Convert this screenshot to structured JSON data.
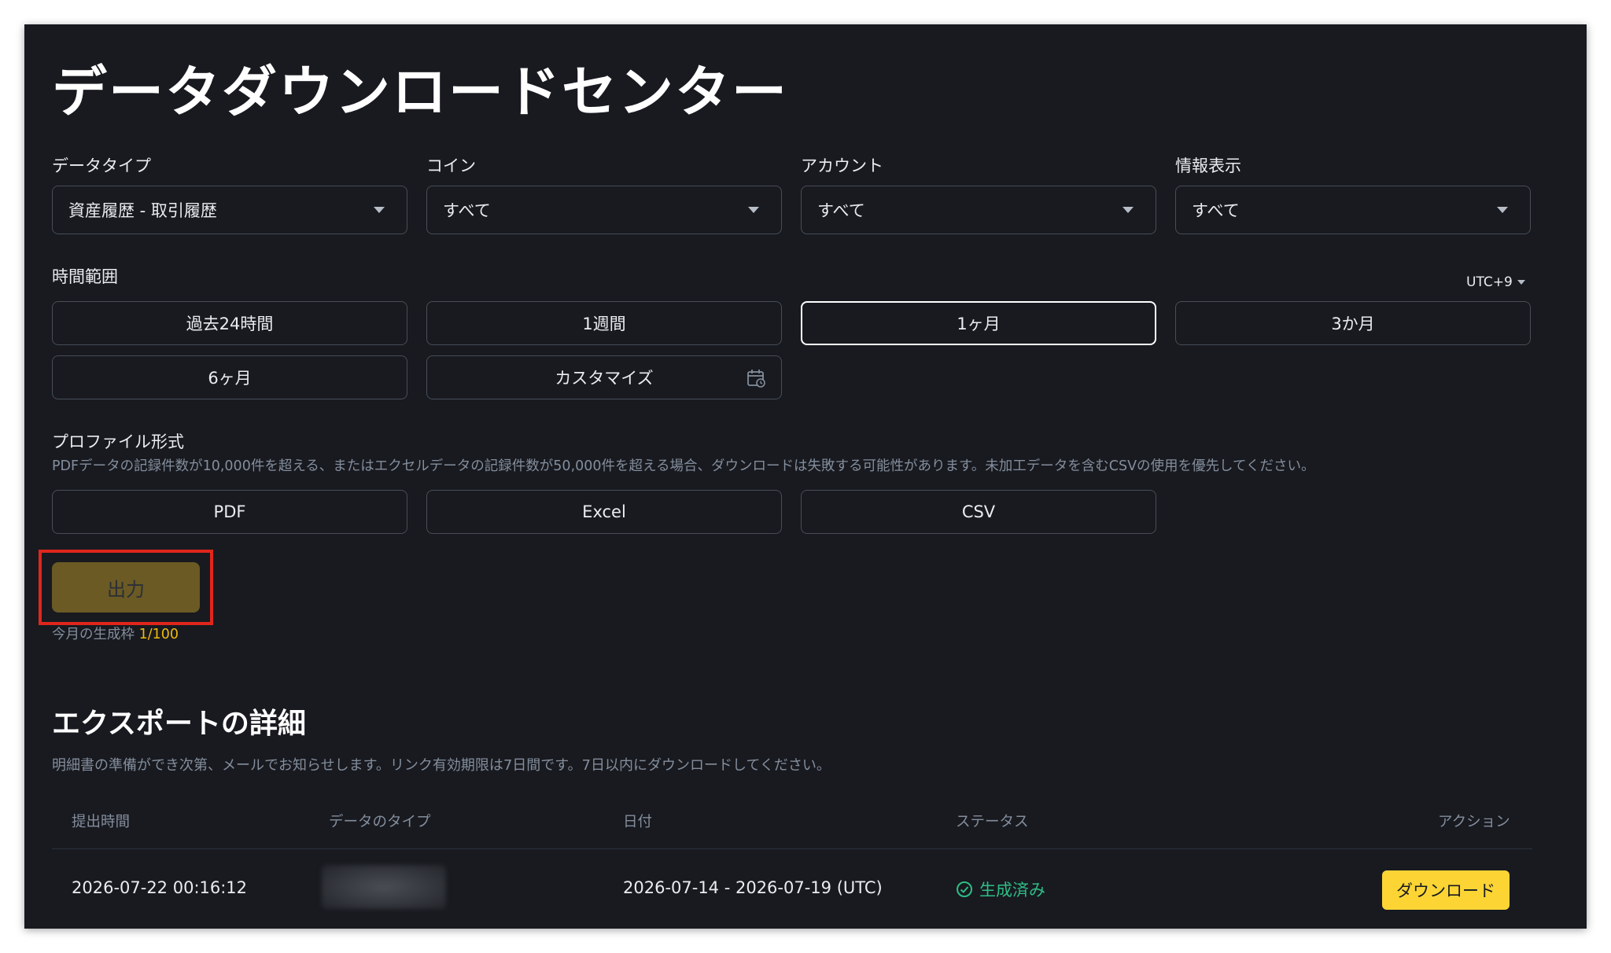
{
  "page": {
    "title": "データダウンロードセンター"
  },
  "filters": [
    {
      "label": "データタイプ",
      "value": "資産履歴 - 取引履歴"
    },
    {
      "label": "コイン",
      "value": "すべて"
    },
    {
      "label": "アカウント",
      "value": "すべて"
    },
    {
      "label": "情報表示",
      "value": "すべて"
    }
  ],
  "time_range": {
    "label": "時間範囲",
    "timezone": "UTC+9",
    "options": [
      "過去24時間",
      "1週間",
      "1ヶ月",
      "3か月",
      "6ヶ月",
      "カスタマイズ"
    ],
    "selected": "1ヶ月"
  },
  "profile_format": {
    "label": "プロファイル形式",
    "note": "PDFデータの記録件数が10,000件を超える、またはエクセルデータの記録件数が50,000件を超える場合、ダウンロードは失敗する可能性があります。未加工データを含むCSVの使用を優先してください。",
    "options": [
      "PDF",
      "Excel",
      "CSV"
    ]
  },
  "export": {
    "button_label": "出力",
    "quota_label": "今月の生成枠",
    "quota_value": "1/100"
  },
  "details": {
    "title": "エクスポートの詳細",
    "description": "明細書の準備ができ次第、メールでお知らせします。リンク有効期限は7日間です。7日以内にダウンロードしてください。",
    "columns": [
      "提出時間",
      "データのタイプ",
      "日付",
      "ステータス",
      "アクション"
    ],
    "rows": [
      {
        "submitted": "2026-07-22 00:16:12",
        "date_range": "2026-07-14 - 2026-07-19 (UTC)",
        "status": "生成済み",
        "action": "ダウンロード"
      }
    ]
  },
  "colors": {
    "background": "#181a20",
    "accent": "#fcd535",
    "success": "#2ebd85",
    "highlight": "#e0261c"
  },
  "icons": {
    "dropdown": "chevron-down-icon",
    "calendar": "calendar-icon",
    "status": "check-circle-icon"
  }
}
